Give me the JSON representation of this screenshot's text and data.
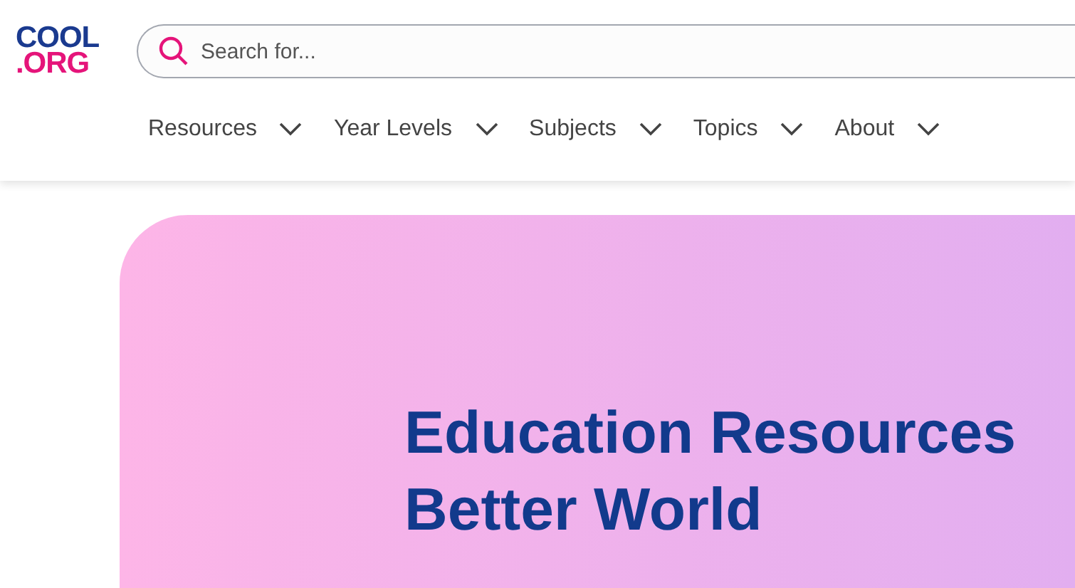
{
  "logo": {
    "line_1": "COOL",
    "line_2": ".ORG"
  },
  "search": {
    "placeholder": "Search for..."
  },
  "nav": [
    {
      "label": "Resources"
    },
    {
      "label": "Year Levels"
    },
    {
      "label": "Subjects"
    },
    {
      "label": "Topics"
    },
    {
      "label": "About"
    }
  ],
  "hero": {
    "heading_lines": [
      "Education Resources",
      "Better World"
    ]
  }
}
